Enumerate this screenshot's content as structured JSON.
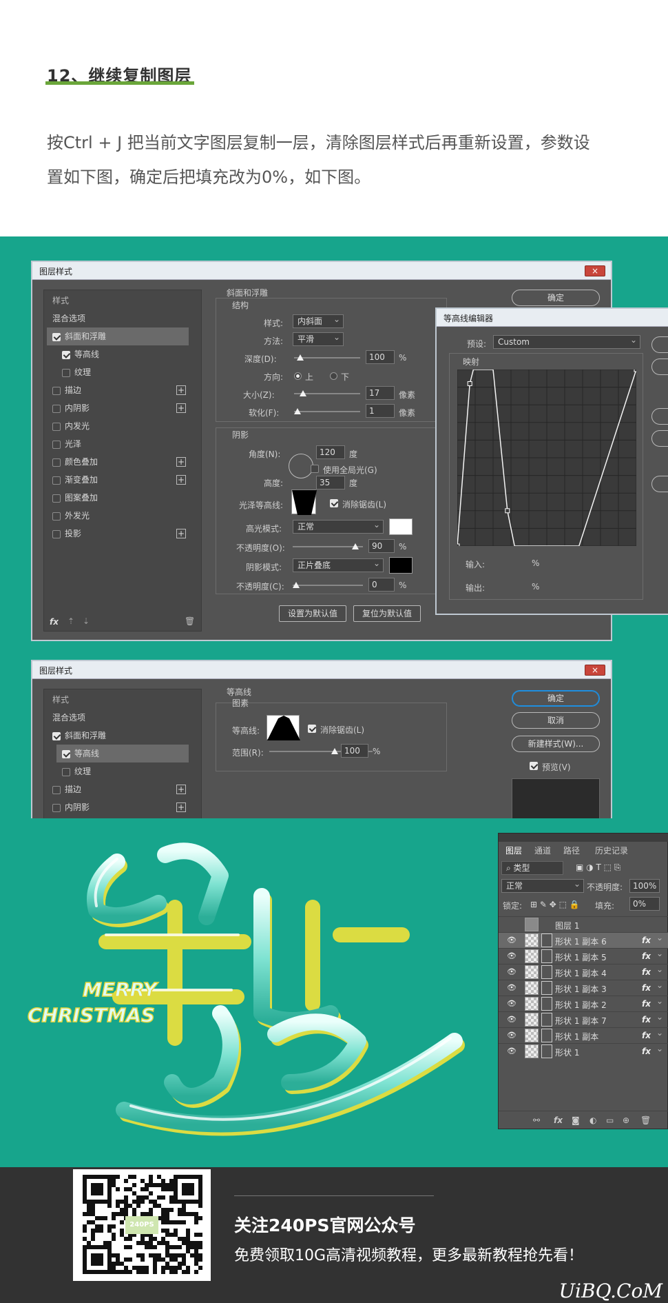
{
  "article": {
    "step_title": "12、继续复制图层",
    "body_line1": "按Ctrl + J 把当前文字图层复制一层，清除图层样式后再重新设置，参数设",
    "body_line2": "置如下图，确定后把填充改为0%，如下图。"
  },
  "dialog1": {
    "title": "图层样式",
    "close": "×",
    "left_panel": {
      "header": "样式",
      "items": [
        "混合选项",
        "斜面和浮雕",
        "等高线",
        "纹理",
        "描边",
        "内阴影",
        "内发光",
        "光泽",
        "颜色叠加",
        "渐变叠加",
        "图案叠加",
        "外发光",
        "投影"
      ],
      "fx": "fx"
    },
    "bevel": {
      "section": "斜面和浮雕",
      "structure": "结构",
      "style_label": "样式:",
      "style_value": "内斜面",
      "method_label": "方法:",
      "method_value": "平滑",
      "depth_label": "深度(D):",
      "depth_value": "100",
      "pct": "%",
      "direction_label": "方向:",
      "dir_up": "上",
      "dir_down": "下",
      "size_label": "大小(Z):",
      "size_value": "17",
      "size_unit": "像素",
      "soften_label": "软化(F):",
      "soften_value": "1",
      "soften_unit": "像素",
      "shading": "阴影",
      "angle_label": "角度(N):",
      "angle_value": "120",
      "deg": "度",
      "global_light": "使用全局光(G)",
      "altitude_label": "高度:",
      "altitude_value": "35",
      "gloss_label": "光泽等高线:",
      "antialias": "消除锯齿(L)",
      "highlight_label": "高光模式:",
      "highlight_mode": "正常",
      "hl_opacity_label": "不透明度(O):",
      "hl_opacity_value": "90",
      "shadow_label": "阴影模式:",
      "shadow_mode": "正片叠底",
      "sh_opacity_label": "不透明度(C):",
      "sh_opacity_value": "0",
      "btn_default": "设置为默认值",
      "btn_reset": "复位为默认值",
      "btn_ok": "确定",
      "hl_color": "#ffffff",
      "sh_color": "#000000"
    }
  },
  "contour_editor": {
    "title": "等高线编辑器",
    "preset_label": "预设:",
    "preset_value": "Custom",
    "mapping": "映射",
    "input_label": "输入:",
    "output_label": "输出:",
    "pct": "%"
  },
  "dialog2": {
    "title": "图层样式",
    "close": "×",
    "left_panel": {
      "header": "样式",
      "items": [
        "混合选项",
        "斜面和浮雕",
        "等高线",
        "纹理",
        "描边",
        "内阴影"
      ]
    },
    "contour": {
      "section": "等高线",
      "elements": "图素",
      "contour_label": "等高线:",
      "antialias": "消除锯齿(L)",
      "range_label": "范围(R):",
      "range_value": "100",
      "pct": "%"
    },
    "buttons": {
      "ok": "确定",
      "cancel": "取消",
      "new_style": "新建样式(W)...",
      "preview": "预览(V)"
    }
  },
  "artwork": {
    "merry": "MERRY",
    "christmas": "CHRISTMAS"
  },
  "layers_panel": {
    "tabs": [
      "图层",
      "通道",
      "路径",
      "历史记录"
    ],
    "filter": "类型",
    "blend_mode": "正常",
    "opacity_label": "不透明度:",
    "opacity_value": "100%",
    "lock_label": "锁定:",
    "fill_label": "填充:",
    "fill_value": "0%",
    "layers": [
      {
        "name": "图层 1",
        "fx": ""
      },
      {
        "name": "形状 1 副本 6",
        "fx": "fx"
      },
      {
        "name": "形状 1 副本 5",
        "fx": "fx"
      },
      {
        "name": "形状 1 副本 4",
        "fx": "fx"
      },
      {
        "name": "形状 1 副本 3",
        "fx": "fx"
      },
      {
        "name": "形状 1 副本 2",
        "fx": "fx"
      },
      {
        "name": "形状 1 副本 7",
        "fx": "fx"
      },
      {
        "name": "形状 1 副本",
        "fx": "fx"
      },
      {
        "name": "形状 1",
        "fx": "fx"
      }
    ]
  },
  "footer": {
    "follow": "关注240PS官网公众号",
    "promo": "免费领取10G高清视频教程，更多最新教程抢先看！",
    "watermark": "UiBQ.CoM",
    "qr_center": "240PS"
  }
}
